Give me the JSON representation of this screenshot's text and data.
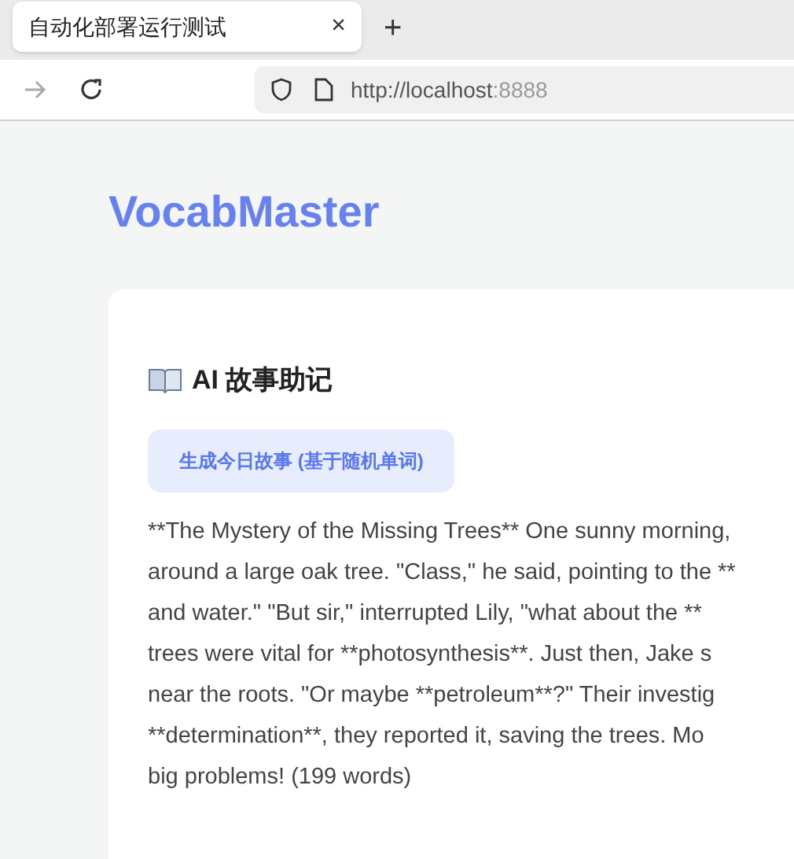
{
  "browser": {
    "tab": {
      "title": "自动化部署运行测试",
      "close": "×"
    },
    "new_tab": "+",
    "url": {
      "host": "http://localhost",
      "port": ":8888"
    }
  },
  "app": {
    "title": "VocabMaster"
  },
  "story_card": {
    "heading": "AI 故事助记",
    "button": "生成今日故事 (基于随机单词)",
    "lines": [
      "**The Mystery of the Missing Trees** One sunny morning,",
      "around a large oak tree. \"Class,\" he said, pointing to the **",
      "and water.\" \"But sir,\" interrupted Lily, \"what about the **",
      "trees were vital for **photosynthesis**. Just then, Jake s",
      "near the roots. \"Or maybe **petroleum**?\" Their investig",
      "**determination**, they reported it, saving the trees. Mo",
      "big problems! (199 words)"
    ]
  }
}
